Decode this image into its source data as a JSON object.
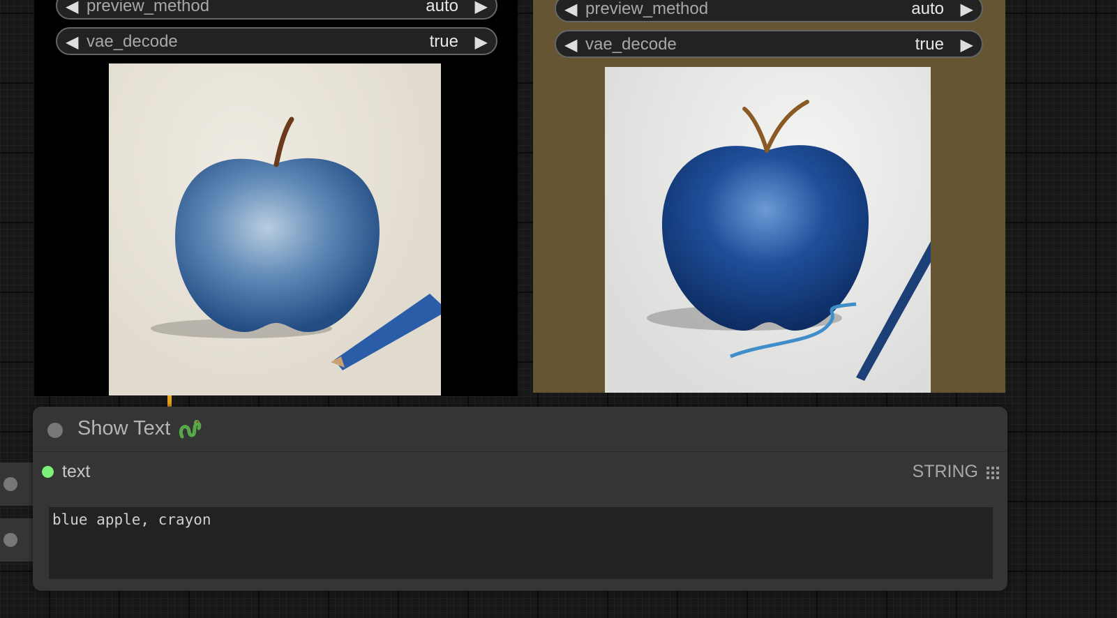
{
  "left_node": {
    "preview_method": {
      "name": "preview_method",
      "value": "auto"
    },
    "vae_decode": {
      "name": "vae_decode",
      "value": "true"
    },
    "image": "blue apple crayon drawing with blue crayon"
  },
  "right_node": {
    "preview_method": {
      "name": "preview_method",
      "value": "auto"
    },
    "vae_decode": {
      "name": "vae_decode",
      "value": "true"
    },
    "image": "glossy blue apple with dripping paint and blue pencil"
  },
  "show_text_node": {
    "title": "Show Text",
    "title_icon": "snake-icon",
    "slot_label": "text",
    "slot_type": "STRING",
    "text_value": "blue apple, crayon"
  },
  "colors": {
    "right_node_bg": "#665533",
    "slot_connected": "#7bf07b",
    "wire": "#e5a321"
  }
}
